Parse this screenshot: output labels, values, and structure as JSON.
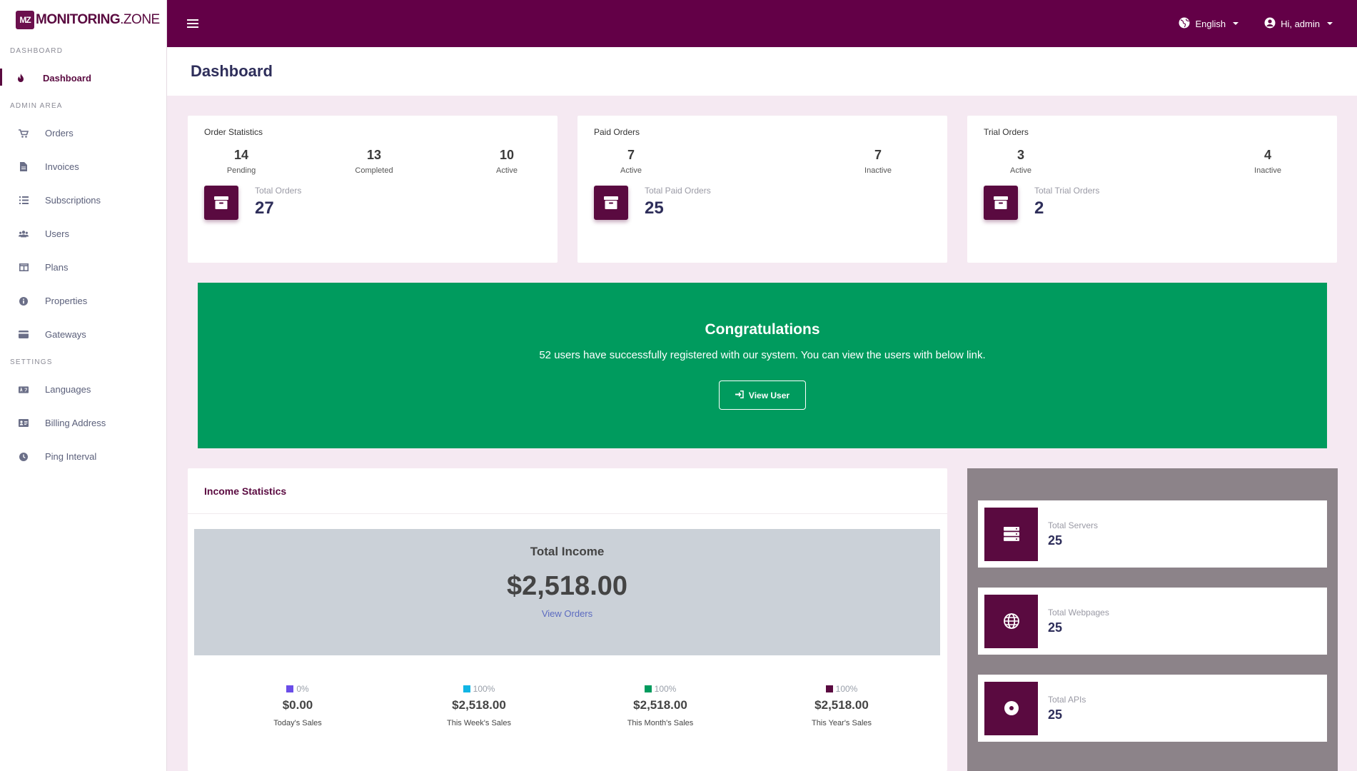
{
  "brand": {
    "mark": "MZ",
    "name_bold": "MONITORING",
    "name_thin": ".ZONE"
  },
  "sidebar": {
    "sections": [
      {
        "title": "DASHBOARD",
        "items": [
          {
            "label": "Dashboard",
            "icon": "fire-icon"
          }
        ]
      },
      {
        "title": "ADMIN AREA",
        "items": [
          {
            "label": "Orders",
            "icon": "cart-icon"
          },
          {
            "label": "Invoices",
            "icon": "file-icon"
          },
          {
            "label": "Subscriptions",
            "icon": "list-icon"
          },
          {
            "label": "Users",
            "icon": "users-icon"
          },
          {
            "label": "Plans",
            "icon": "columns-icon"
          },
          {
            "label": "Properties",
            "icon": "info-icon"
          },
          {
            "label": "Gateways",
            "icon": "credit-card-icon"
          }
        ]
      },
      {
        "title": "SETTINGS",
        "items": [
          {
            "label": "Languages",
            "icon": "language-icon"
          },
          {
            "label": "Billing Address",
            "icon": "address-card-icon"
          },
          {
            "label": "Ping Interval",
            "icon": "clock-icon"
          }
        ]
      }
    ]
  },
  "topbar": {
    "language": "English",
    "user": "Hi, admin"
  },
  "page": {
    "title": "Dashboard"
  },
  "order_statistics": {
    "title": "Order Statistics",
    "stats": [
      {
        "value": "14",
        "label": "Pending"
      },
      {
        "value": "13",
        "label": "Completed"
      },
      {
        "value": "10",
        "label": "Active"
      }
    ],
    "total_label": "Total Orders",
    "total_value": "27"
  },
  "paid_orders": {
    "title": "Paid Orders",
    "stats": [
      {
        "value": "7",
        "label": "Active"
      },
      {
        "value": "7",
        "label": "Inactive"
      }
    ],
    "total_label": "Total Paid Orders",
    "total_value": "25"
  },
  "trial_orders": {
    "title": "Trial Orders",
    "stats": [
      {
        "value": "3",
        "label": "Active"
      },
      {
        "value": "4",
        "label": "Inactive"
      }
    ],
    "total_label": "Total Trial Orders",
    "total_value": "2"
  },
  "banner": {
    "title": "Congratulations",
    "message": "52 users have successfully registered with our system. You can view the users with below link.",
    "button": "View User"
  },
  "income": {
    "title": "Income Statistics",
    "total_title": "Total Income",
    "total_amount": "$2,518.00",
    "link": "View Orders",
    "sales": [
      {
        "pct": "0%",
        "amount": "$0.00",
        "label": "Today's Sales",
        "color": "#6a4de8"
      },
      {
        "pct": "100%",
        "amount": "$2,518.00",
        "label": "This Week's Sales",
        "color": "#11b5e4"
      },
      {
        "pct": "100%",
        "amount": "$2,518.00",
        "label": "This Month's Sales",
        "color": "#009b5e"
      },
      {
        "pct": "100%",
        "amount": "$2,518.00",
        "label": "This Year's Sales",
        "color": "#5a0a40"
      }
    ]
  },
  "resources": [
    {
      "label": "Total Servers",
      "value": "25",
      "icon": "server-icon"
    },
    {
      "label": "Total Webpages",
      "value": "25",
      "icon": "globe-icon"
    },
    {
      "label": "Total APIs",
      "value": "25",
      "icon": "disc-icon"
    }
  ],
  "colors": {
    "brand": "#630047",
    "success": "#009b5e",
    "panel": "#8c8389"
  }
}
